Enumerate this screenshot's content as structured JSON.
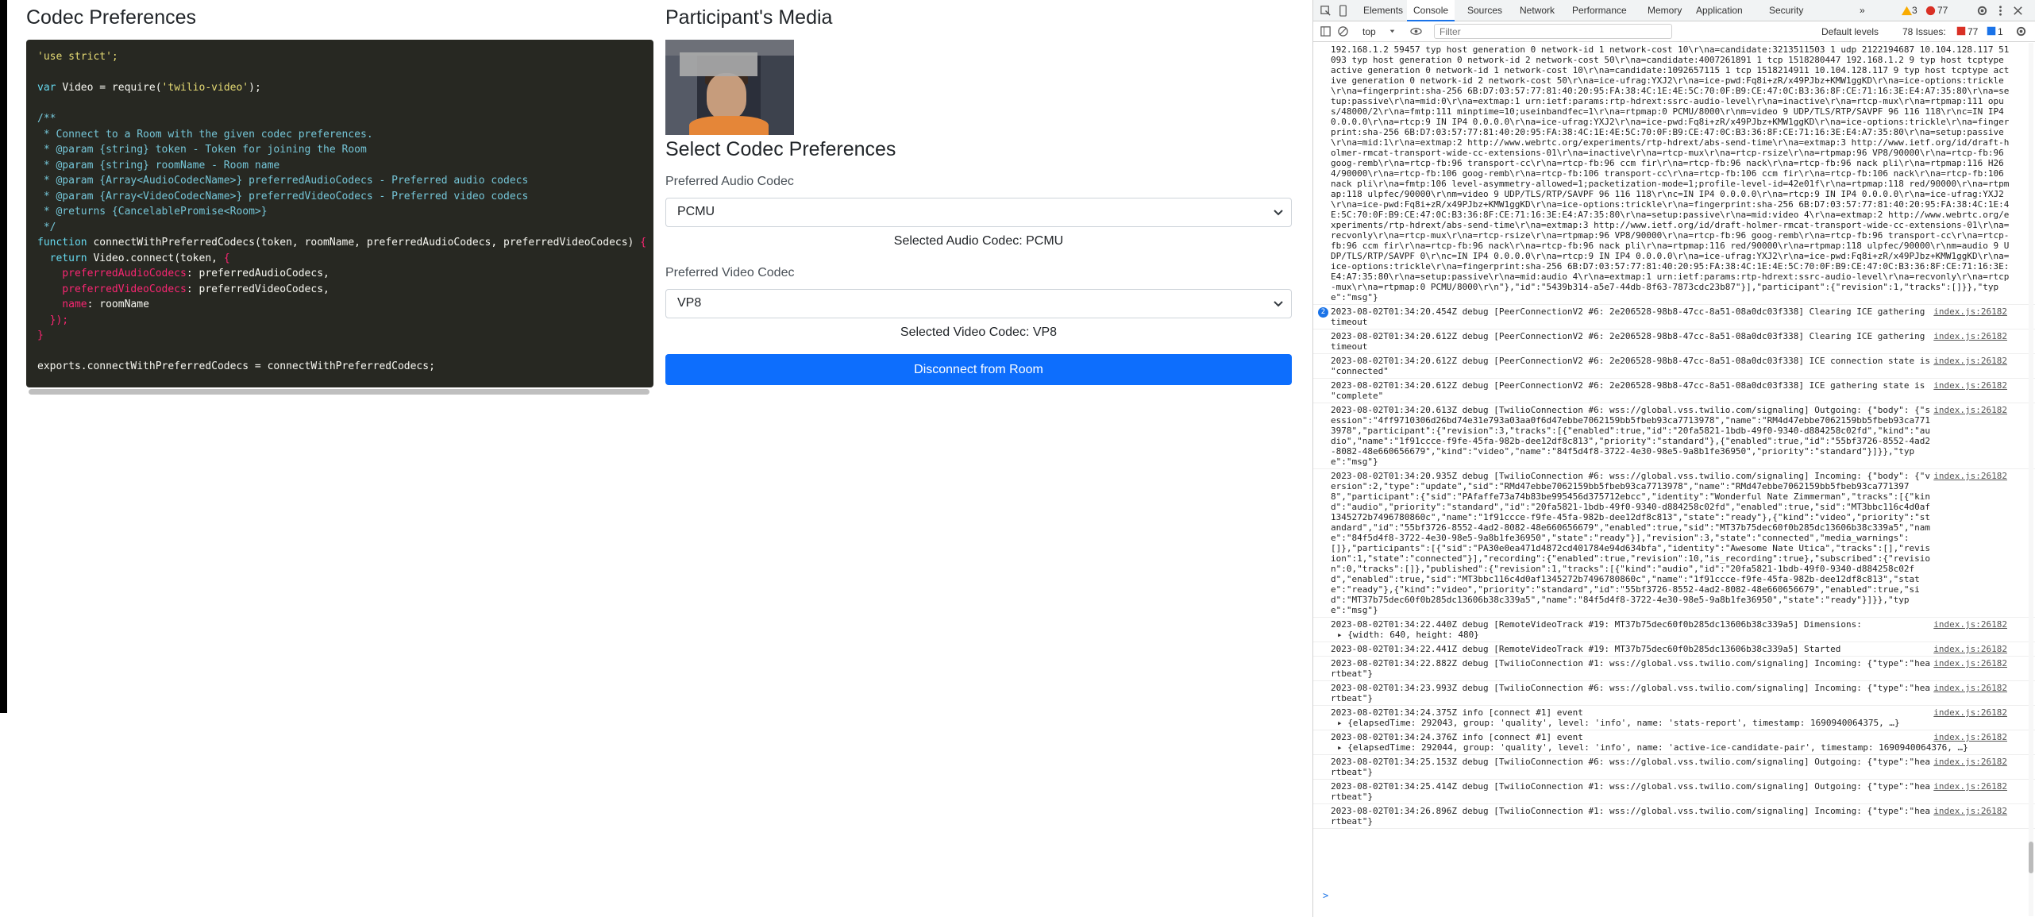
{
  "left": {
    "codec_prefs_title": "Codec Preferences",
    "media_title": "Participant's Media",
    "select_title": "Select Codec Preferences",
    "audio_label": "Preferred Audio Codec",
    "audio_value": "PCMU",
    "audio_selected": "Selected Audio Codec: PCMU",
    "video_label": "Preferred Video Codec",
    "video_value": "VP8",
    "video_selected": "Selected Video Codec: VP8",
    "disconnect_label": "Disconnect from Room"
  },
  "code": [
    [
      {
        "t": "'use strict';",
        "c": "c-str"
      }
    ],
    [],
    [
      {
        "t": "var ",
        "c": "c-kw"
      },
      {
        "t": "Video = require(",
        "c": "c-plain"
      },
      {
        "t": "'twilio-video'",
        "c": "c-str"
      },
      {
        "t": ");",
        "c": "c-plain"
      }
    ],
    [],
    [
      {
        "t": "/**",
        "c": "c-cm"
      }
    ],
    [
      {
        "t": " * Connect to a Room with the given codec preferences.",
        "c": "c-cm"
      }
    ],
    [
      {
        "t": " * @param {string} token - Token for joining the Room",
        "c": "c-cm"
      }
    ],
    [
      {
        "t": " * @param {string} roomName - Room name",
        "c": "c-cm"
      }
    ],
    [
      {
        "t": " * @param {Array<AudioCodecName>} preferredAudioCodecs - Preferred audio codecs",
        "c": "c-cm"
      }
    ],
    [
      {
        "t": " * @param {Array<VideoCodecName>} preferredVideoCodecs - Preferred video codecs",
        "c": "c-cm"
      }
    ],
    [
      {
        "t": " * @returns {CancelablePromise<Room>}",
        "c": "c-cm"
      }
    ],
    [
      {
        "t": " */",
        "c": "c-cm"
      }
    ],
    [
      {
        "t": "function ",
        "c": "c-kw"
      },
      {
        "t": "connectWithPreferredCodecs",
        "c": "c-plain"
      },
      {
        "t": "(token, roomName, preferredAudioCodecs, preferredVideoCodecs) ",
        "c": "c-plain"
      },
      {
        "t": "{",
        "c": "c-kw2"
      }
    ],
    [
      {
        "t": "  return ",
        "c": "c-kw"
      },
      {
        "t": "Video.connect(token, ",
        "c": "c-plain"
      },
      {
        "t": "{",
        "c": "c-kw2"
      }
    ],
    [
      {
        "t": "    preferredAudioCodecs",
        "c": "c-prop"
      },
      {
        "t": ": preferredAudioCodecs,",
        "c": "c-plain"
      }
    ],
    [
      {
        "t": "    preferredVideoCodecs",
        "c": "c-prop"
      },
      {
        "t": ": preferredVideoCodecs,",
        "c": "c-plain"
      }
    ],
    [
      {
        "t": "    name",
        "c": "c-prop"
      },
      {
        "t": ": roomName",
        "c": "c-plain"
      }
    ],
    [
      {
        "t": "  });",
        "c": "c-kw2"
      }
    ],
    [
      {
        "t": "}",
        "c": "c-kw2"
      }
    ],
    [],
    [
      {
        "t": "exports.connectWithPreferredCodecs = connectWithPreferredCodecs;",
        "c": "c-plain"
      }
    ]
  ],
  "devtools": {
    "tabs": [
      "Elements",
      "Console",
      "Sources",
      "Network",
      "Performance",
      "Memory",
      "Application",
      "Security"
    ],
    "active_tab": "Console",
    "more": "»",
    "warn_count": "3",
    "error_count": "77",
    "context": "top",
    "filter_placeholder": "Filter",
    "levels": "Default levels",
    "issues_label": "78 Issues:",
    "issues_errors": "77",
    "issues_info": "1",
    "prompt": ">"
  },
  "console": [
    {
      "text": "192.168.1.2 59457 typ host generation 0 network-id 1 network-cost 10\\r\\na=candidate:3213511503 1 udp 2122194687 10.104.128.117 51093 typ host generation 0 network-id 2 network-cost 50\\r\\na=candidate:4007261891 1 tcp 1518280447 192.168.1.2 9 typ host tcptype active generation 0 network-id 1 network-cost 10\\r\\na=candidate:1092657115 1 tcp 1518214911 10.104.128.117 9 typ host tcptype active generation 0 network-id 2 network-cost 50\\r\\na=ice-ufrag:YXJ2\\r\\na=ice-pwd:Fq8i+zR/x49PJbz+KMW1ggKD\\r\\na=ice-options:trickle\\r\\na=fingerprint:sha-256 6B:D7:03:57:77:81:40:20:95:FA:38:4C:1E:4E:5C:70:0F:B9:CE:47:0C:B3:36:8F:CE:71:16:3E:E4:A7:35:80\\r\\na=setup:passive\\r\\na=mid:0\\r\\na=extmap:1 urn:ietf:params:rtp-hdrext:ssrc-audio-level\\r\\na=inactive\\r\\na=rtcp-mux\\r\\na=rtpmap:111 opus/48000/2\\r\\na=fmtp:111 minptime=10;useinbandfec=1\\r\\na=rtpmap:0 PCMU/8000\\r\\nm=video 9 UDP/TLS/RTP/SAVPF 96 116 118\\r\\nc=IN IP4 0.0.0.0\\r\\na=rtcp:9 IN IP4 0.0.0.0\\r\\na=ice-ufrag:YXJ2\\r\\na=ice-pwd:Fq8i+zR/x49PJbz+KMW1ggKD\\r\\na=ice-options:trickle\\r\\na=fingerprint:sha-256 6B:D7:03:57:77:81:40:20:95:FA:38:4C:1E:4E:5C:70:0F:B9:CE:47:0C:B3:36:8F:CE:71:16:3E:E4:A7:35:80\\r\\na=setup:passive\\r\\na=mid:1\\r\\na=extmap:2 http://www.webrtc.org/experiments/rtp-hdrext/abs-send-time\\r\\na=extmap:3 http://www.ietf.org/id/draft-holmer-rmcat-transport-wide-cc-extensions-01\\r\\na=inactive\\r\\na=rtcp-mux\\r\\na=rtcp-rsize\\r\\na=rtpmap:96 VP8/90000\\r\\na=rtcp-fb:96 goog-remb\\r\\na=rtcp-fb:96 transport-cc\\r\\na=rtcp-fb:96 ccm fir\\r\\na=rtcp-fb:96 nack\\r\\na=rtcp-fb:96 nack pli\\r\\na=rtpmap:116 H264/90000\\r\\na=rtcp-fb:106 goog-remb\\r\\na=rtcp-fb:106 transport-cc\\r\\na=rtcp-fb:106 ccm fir\\r\\na=rtcp-fb:106 nack\\r\\na=rtcp-fb:106 nack pli\\r\\na=fmtp:106 level-asymmetry-allowed=1;packetization-mode=1;profile-level-id=42e01f\\r\\na=rtpmap:118 red/90000\\r\\na=rtpmap:118 ulpfec/90000\\r\\nm=video 9 UDP/TLS/RTP/SAVPF 96 116 118\\r\\nc=IN IP4 0.0.0.0\\r\\na=rtcp:9 IN IP4 0.0.0.0\\r\\na=ice-ufrag:YXJ2\\r\\na=ice-pwd:Fq8i+zR/x49PJbz+KMW1ggKD\\r\\na=ice-options:trickle\\r\\na=fingerprint:sha-256 6B:D7:03:57:77:81:40:20:95:FA:38:4C:1E:4E:5C:70:0F:B9:CE:47:0C:B3:36:8F:CE:71:16:3E:E4:A7:35:80\\r\\na=setup:passive\\r\\na=mid:video 4\\r\\na=extmap:2 http://www.webrtc.org/experiments/rtp-hdrext/abs-send-time\\r\\na=extmap:3 http://www.ietf.org/id/draft-holmer-rmcat-transport-wide-cc-extensions-01\\r\\na=recvonly\\r\\na=rtcp-mux\\r\\na=rtcp-rsize\\r\\na=rtpmap:96 VP8/90000\\r\\na=rtcp-fb:96 goog-remb\\r\\na=rtcp-fb:96 transport-cc\\r\\na=rtcp-fb:96 ccm fir\\r\\na=rtcp-fb:96 nack\\r\\na=rtcp-fb:96 nack pli\\r\\na=rtpmap:116 red/90000\\r\\na=rtpmap:118 ulpfec/90000\\r\\nm=audio 9 UDP/TLS/RTP/SAVPF 0\\r\\nc=IN IP4 0.0.0.0\\r\\na=rtcp:9 IN IP4 0.0.0.0\\r\\na=ice-ufrag:YXJ2\\r\\na=ice-pwd:Fq8i+zR/x49PJbz+KMW1ggKD\\r\\na=ice-options:trickle\\r\\na=fingerprint:sha-256 6B:D7:03:57:77:81:40:20:95:FA:38:4C:1E:4E:5C:70:0F:B9:CE:47:0C:B3:36:8F:CE:71:16:3E:E4:A7:35:80\\r\\na=setup:passive\\r\\na=mid:audio 4\\r\\na=extmap:1 urn:ietf:params:rtp-hdrext:ssrc-audio-level\\r\\na=recvonly\\r\\na=rtcp-mux\\r\\na=rtpmap:0 PCMU/8000\\r\\n\"},\"id\":\"5439b314-a5e7-44db-8f63-7873cdc23b87\"}],\"participant\":{\"revision\":1,\"tracks\":[]}},\"type\":\"msg\"}",
      "src": "",
      "full": true
    },
    {
      "text": "2023-08-02T01:34:20.454Z debug [PeerConnectionV2 #6: 2e206528-98b8-47cc-8a51-08a0dc03f338] Clearing ICE gathering timeout",
      "src": "index.js:26182",
      "badge": "2"
    },
    {
      "text": "2023-08-02T01:34:20.612Z debug [PeerConnectionV2 #6: 2e206528-98b8-47cc-8a51-08a0dc03f338] Clearing ICE gathering timeout",
      "src": "index.js:26182"
    },
    {
      "text": "2023-08-02T01:34:20.612Z debug [PeerConnectionV2 #6: 2e206528-98b8-47cc-8a51-08a0dc03f338] ICE connection state is \"connected\"",
      "src": "index.js:26182"
    },
    {
      "text": "2023-08-02T01:34:20.612Z debug [PeerConnectionV2 #6: 2e206528-98b8-47cc-8a51-08a0dc03f338] ICE gathering state is \"complete\"",
      "src": "index.js:26182"
    },
    {
      "text": "2023-08-02T01:34:20.613Z debug [TwilioConnection #6: wss://global.vss.twilio.com/signaling] Outgoing: {\"body\": {\"session\":\"4ff9710306d26bd74e31e793a03aa0f6d47ebbe7062159bb5fbeb93ca7713978\",\"name\":\"RM4d47ebbe7062159bb5fbeb93ca7713978\",\"participant\":{\"revision\":3,\"tracks\":[{\"enabled\":true,\"id\":\"20fa5821-1bdb-49f0-9340-d884258c02fd\",\"kind\":\"audio\",\"name\":\"1f91ccce-f9fe-45fa-982b-dee12df8c813\",\"priority\":\"standard\"},{\"enabled\":true,\"id\":\"55bf3726-8552-4ad2-8082-48e660656679\",\"kind\":\"video\",\"name\":\"84f5d4f8-3722-4e30-98e5-9a8b1fe36950\",\"priority\":\"standard\"}]}},\"type\":\"msg\"}",
      "src": "index.js:26182"
    },
    {
      "text": "2023-08-02T01:34:20.935Z debug [TwilioConnection #6: wss://global.vss.twilio.com/signaling] Incoming: {\"body\": {\"version\":2,\"type\":\"update\",\"sid\":\"RMd47ebbe7062159bb5fbeb93ca7713978\",\"name\":\"RMd47ebbe7062159bb5fbeb93ca7713978\",\"participant\":{\"sid\":\"PAfaffe73a74b83be995456d375712ebcc\",\"identity\":\"Wonderful Nate Zimmerman\",\"tracks\":[{\"kind\":\"audio\",\"priority\":\"standard\",\"id\":\"20fa5821-1bdb-49f0-9340-d884258c02fd\",\"enabled\":true,\"sid\":\"MT3bbc116c4d0af1345272b7496780860c\",\"name\":\"1f91ccce-f9fe-45fa-982b-dee12df8c813\",\"state\":\"ready\"},{\"kind\":\"video\",\"priority\":\"standard\",\"id\":\"55bf3726-8552-4ad2-8082-48e660656679\",\"enabled\":true,\"sid\":\"MT37b75dec60f0b285dc13606b38c339a5\",\"name\":\"84f5d4f8-3722-4e30-98e5-9a8b1fe36950\",\"state\":\"ready\"}],\"revision\":3,\"state\":\"connected\",\"media_warnings\":[]},\"participants\":[{\"sid\":\"PA30e0ea471d4872cd401784e94d634bfa\",\"identity\":\"Awesome Nate Utica\",\"tracks\":[],\"revision\":1,\"state\":\"connected\"}],\"recording\":{\"enabled\":true,\"revision\":10,\"is_recording\":true},\"subscribed\":{\"revision\":0,\"tracks\":[]},\"published\":{\"revision\":1,\"tracks\":[{\"kind\":\"audio\",\"id\":\"20fa5821-1bdb-49f0-9340-d884258c02fd\",\"enabled\":true,\"sid\":\"MT3bbc116c4d0af1345272b7496780860c\",\"name\":\"1f91ccce-f9fe-45fa-982b-dee12df8c813\",\"state\":\"ready\"},{\"kind\":\"video\",\"priority\":\"standard\",\"id\":\"55bf3726-8552-4ad2-8082-48e660656679\",\"enabled\":true,\"sid\":\"MT37b75dec60f0b285dc13606b38c339a5\",\"name\":\"84f5d4f8-3722-4e30-98e5-9a8b1fe36950\",\"state\":\"ready\"}]}},\"type\":\"msg\"}",
      "src": "index.js:26182"
    },
    {
      "text": "2023-08-02T01:34:22.440Z debug [RemoteVideoTrack #19: MT37b75dec60f0b285dc13606b38c339a5] Dimensions:",
      "src": "index.js:26182",
      "obj": "{width: 640, height: 480}"
    },
    {
      "text": "2023-08-02T01:34:22.441Z debug [RemoteVideoTrack #19: MT37b75dec60f0b285dc13606b38c339a5] Started",
      "src": "index.js:26182"
    },
    {
      "text": "2023-08-02T01:34:22.882Z debug [TwilioConnection #1: wss://global.vss.twilio.com/signaling] Incoming: {\"type\":\"heartbeat\"}",
      "src": "index.js:26182"
    },
    {
      "text": "2023-08-02T01:34:23.993Z debug [TwilioConnection #6: wss://global.vss.twilio.com/signaling] Incoming: {\"type\":\"heartbeat\"}",
      "src": "index.js:26182"
    },
    {
      "text": "2023-08-02T01:34:24.375Z info [connect #1] event",
      "src": "index.js:26182",
      "obj": "{elapsedTime: 292043, group: 'quality', level: 'info', name: 'stats-report', timestamp: 1690940064375, …}"
    },
    {
      "text": "2023-08-02T01:34:24.376Z info [connect #1] event",
      "src": "index.js:26182",
      "obj": "{elapsedTime: 292044, group: 'quality', level: 'info', name: 'active-ice-candidate-pair', timestamp: 1690940064376, …}"
    },
    {
      "text": "2023-08-02T01:34:25.153Z debug [TwilioConnection #6: wss://global.vss.twilio.com/signaling] Outgoing: {\"type\":\"heartbeat\"}",
      "src": "index.js:26182"
    },
    {
      "text": "2023-08-02T01:34:25.414Z debug [TwilioConnection #1: wss://global.vss.twilio.com/signaling] Outgoing: {\"type\":\"heartbeat\"}",
      "src": "index.js:26182"
    },
    {
      "text": "2023-08-02T01:34:26.896Z debug [TwilioConnection #1: wss://global.vss.twilio.com/signaling] Incoming: {\"type\":\"heartbeat\"}",
      "src": "index.js:26182"
    }
  ]
}
